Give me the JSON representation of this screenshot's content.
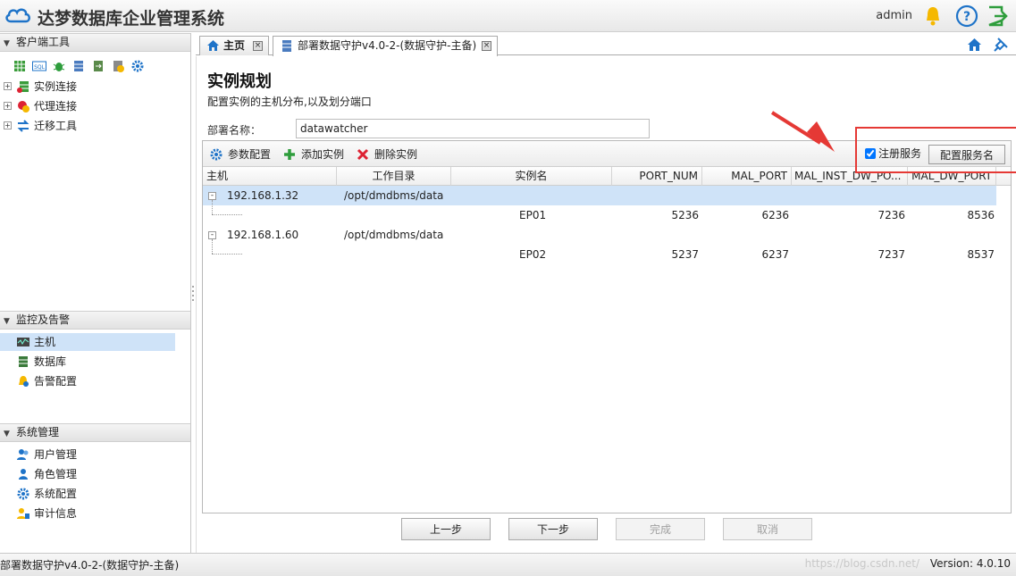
{
  "header": {
    "title": "达梦数据库企业管理系统",
    "user": "admin"
  },
  "left": {
    "client_tools": {
      "title": "客户端工具",
      "tools": [
        "data-grid-icon",
        "sql-icon",
        "bug-icon",
        "db-export-icon",
        "db-transfer-icon",
        "db-check-icon",
        "gear-icon"
      ],
      "items": [
        {
          "label": "实例连接",
          "icon": "instance-connect-icon"
        },
        {
          "label": "代理连接",
          "icon": "proxy-connect-icon"
        },
        {
          "label": "迁移工具",
          "icon": "migrate-tool-icon"
        }
      ]
    },
    "monitor": {
      "title": "监控及告警",
      "items": [
        {
          "label": "主机",
          "icon": "host-monitor-icon"
        },
        {
          "label": "数据库",
          "icon": "database-icon"
        },
        {
          "label": "告警配置",
          "icon": "alarm-config-icon"
        }
      ]
    },
    "system": {
      "title": "系统管理",
      "items": [
        {
          "label": "用户管理",
          "icon": "users-icon"
        },
        {
          "label": "角色管理",
          "icon": "role-icon"
        },
        {
          "label": "系统配置",
          "icon": "gear-icon"
        },
        {
          "label": "审计信息",
          "icon": "audit-icon"
        }
      ]
    }
  },
  "tabs": [
    {
      "label": "主页"
    },
    {
      "label": "部署数据守护v4.0-2-(数据守护-主备)"
    }
  ],
  "main": {
    "title": "实例规划",
    "subtitle": "配置实例的主机分布,以及划分端口",
    "deploy_label": "部署名称：",
    "deploy_value": "datawatcher",
    "toolbar": {
      "params": "参数配置",
      "add": "添加实例",
      "delete": "删除实例",
      "register": "注册服务",
      "config_service": "配置服务名"
    },
    "columns": [
      "主机",
      "工作目录",
      "实例名",
      "PORT_NUM",
      "MAL_PORT",
      "MAL_INST_DW_PO...",
      "MAL_DW_PORT"
    ],
    "hosts": [
      {
        "host": "192.168.1.32",
        "dir": "/opt/dmdbms/data",
        "instance": {
          "name": "EP01",
          "port_num": "5236",
          "mal_port": "6236",
          "mal_inst_dw_port": "7236",
          "mal_dw_port": "8536"
        }
      },
      {
        "host": "192.168.1.60",
        "dir": "/opt/dmdbms/data",
        "instance": {
          "name": "EP02",
          "port_num": "5237",
          "mal_port": "6237",
          "mal_inst_dw_port": "7237",
          "mal_dw_port": "8537"
        }
      }
    ],
    "buttons": {
      "prev": "上一步",
      "next": "下一步",
      "finish": "完成",
      "cancel": "取消"
    }
  },
  "status": {
    "left": "部署数据守护v4.0-2-(数据守护-主备)",
    "watermark": "https://blog.csdn.net/",
    "version": "Version: 4.0.10"
  },
  "colors": {
    "accent": "#1e73c8",
    "selection": "#cfe3f8",
    "annotation": "#e53935"
  }
}
